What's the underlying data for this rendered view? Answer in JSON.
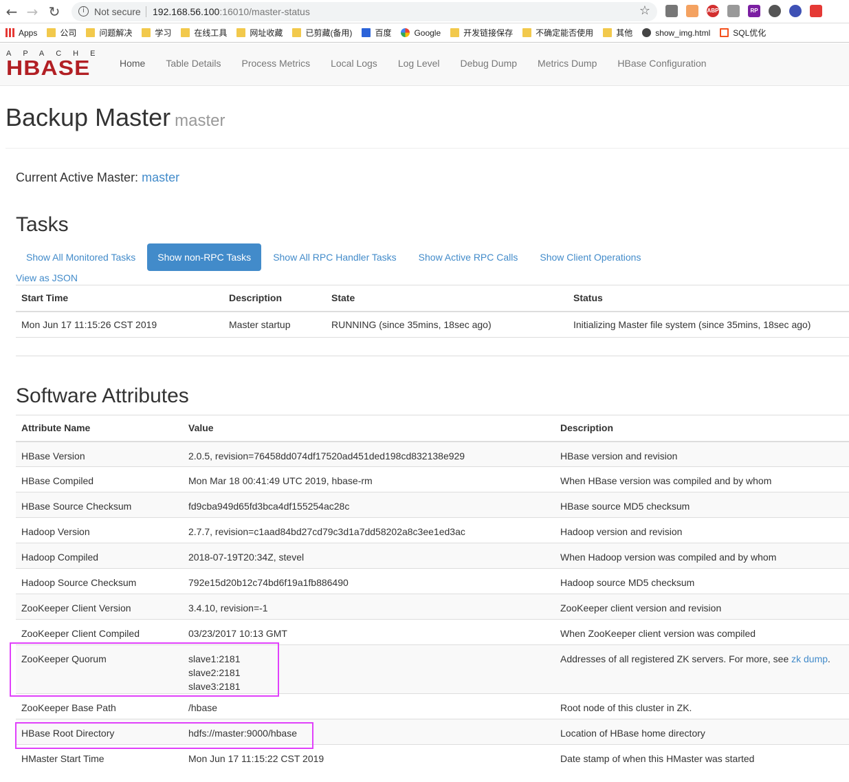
{
  "browser": {
    "info_text": "Not secure",
    "url_host": "192.168.56.100",
    "url_path": ":16010/master-status",
    "bookmarks": [
      "Apps",
      "公司",
      "问题解决",
      "学习",
      "在线工具",
      "网址收藏",
      "已剪藏(备用)",
      "百度",
      "Google",
      "开发链接保存",
      "不确定能否使用",
      "其他",
      "show_img.html",
      "SQL优化"
    ]
  },
  "logo": {
    "apache": "APACHE",
    "hbase": "HBASE"
  },
  "nav": [
    "Home",
    "Table Details",
    "Process Metrics",
    "Local Logs",
    "Log Level",
    "Debug Dump",
    "Metrics Dump",
    "HBase Configuration"
  ],
  "page": {
    "title": "Backup Master",
    "subtitle": "master",
    "active_master_label": "Current Active Master:",
    "active_master_value": "master"
  },
  "tasks": {
    "heading": "Tasks",
    "tabs": [
      "Show All Monitored Tasks",
      "Show non-RPC Tasks",
      "Show All RPC Handler Tasks",
      "Show Active RPC Calls",
      "Show Client Operations"
    ],
    "json_link": "View as JSON",
    "columns": [
      "Start Time",
      "Description",
      "State",
      "Status"
    ],
    "rows": [
      [
        "Mon Jun 17 11:15:26 CST 2019",
        "Master startup",
        "RUNNING (since 35mins, 18sec ago)",
        "Initializing Master file system (since 35mins, 18sec ago)"
      ]
    ]
  },
  "software": {
    "heading": "Software Attributes",
    "columns": [
      "Attribute Name",
      "Value",
      "Description"
    ],
    "rows": [
      {
        "name": "HBase Version",
        "value": "2.0.5, revision=76458dd074df17520ad451ded198cd832138e929",
        "desc": "HBase version and revision"
      },
      {
        "name": "HBase Compiled",
        "value": "Mon Mar 18 00:41:49 UTC 2019, hbase-rm",
        "desc": "When HBase version was compiled and by whom"
      },
      {
        "name": "HBase Source Checksum",
        "value": "fd9cba949d65fd3bca4df155254ac28c",
        "desc": "HBase source MD5 checksum"
      },
      {
        "name": "Hadoop Version",
        "value": "2.7.7, revision=c1aad84bd27cd79c3d1a7dd58202a8c3ee1ed3ac",
        "desc": "Hadoop version and revision"
      },
      {
        "name": "Hadoop Compiled",
        "value": "2018-07-19T20:34Z, stevel",
        "desc": "When Hadoop version was compiled and by whom"
      },
      {
        "name": "Hadoop Source Checksum",
        "value": "792e15d20b12c74bd6f19a1fb886490",
        "desc": "Hadoop source MD5 checksum"
      },
      {
        "name": "ZooKeeper Client Version",
        "value": "3.4.10, revision=-1",
        "desc": "ZooKeeper client version and revision"
      },
      {
        "name": "ZooKeeper Client Compiled",
        "value": "03/23/2017 10:13 GMT",
        "desc": "When ZooKeeper client version was compiled"
      },
      {
        "name": "ZooKeeper Quorum",
        "value_lines": [
          "slave1:2181",
          "slave2:2181",
          "slave3:2181"
        ],
        "desc": "Addresses of all registered ZK servers. For more, see",
        "desc_link": "zk dump",
        "desc_end": "."
      },
      {
        "name": "ZooKeeper Base Path",
        "value": "/hbase",
        "desc": "Root node of this cluster in ZK."
      },
      {
        "name": "HBase Root Directory",
        "value": "hdfs://master:9000/hbase",
        "desc": "Location of HBase home directory"
      },
      {
        "name": "HMaster Start Time",
        "value": "Mon Jun 17 11:15:22 CST 2019",
        "desc": "Date stamp of when this HMaster was started"
      }
    ]
  }
}
